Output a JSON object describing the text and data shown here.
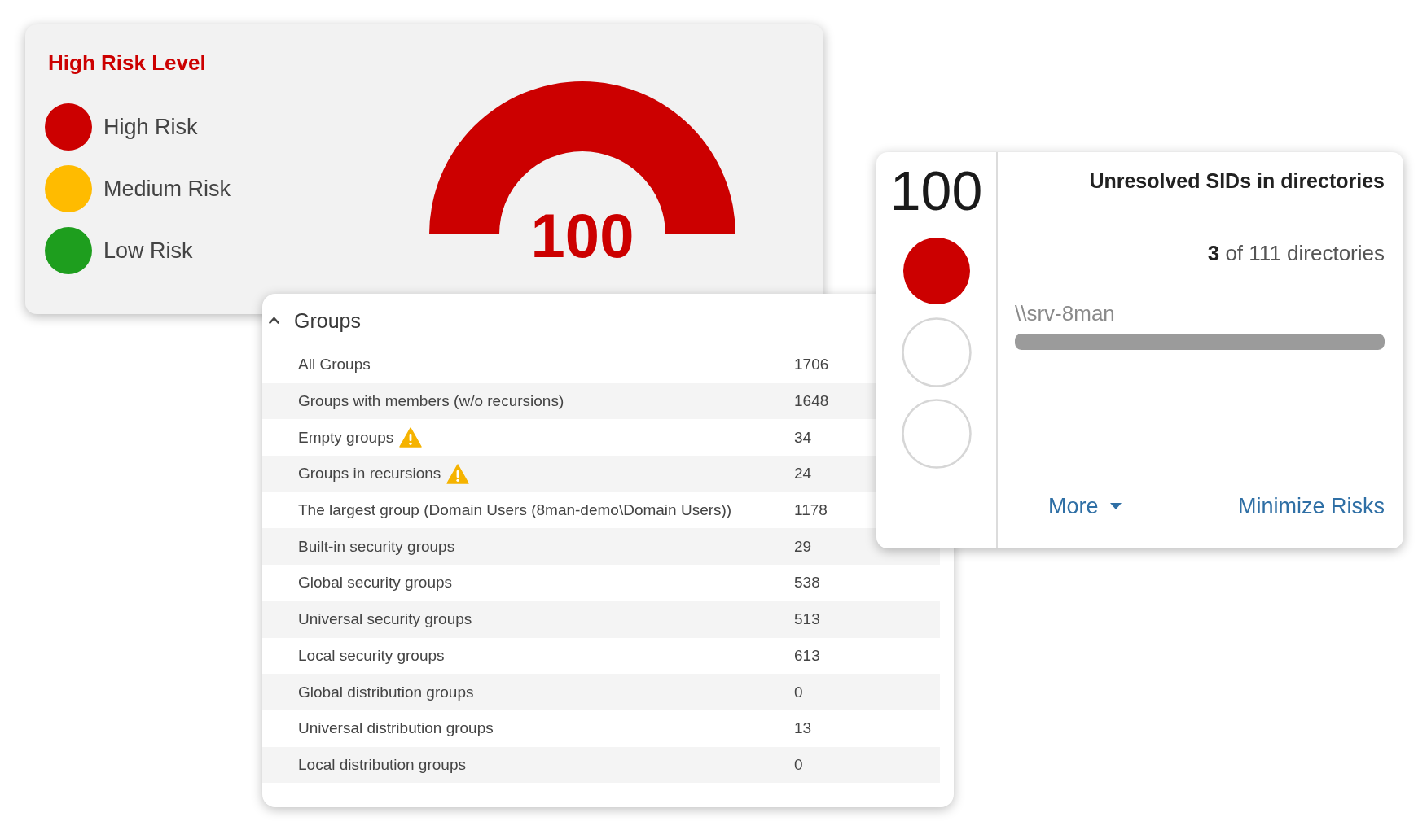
{
  "risk_card": {
    "title": "High Risk Level",
    "legend": [
      {
        "label": "High Risk",
        "color": "#cc0000"
      },
      {
        "label": "Medium Risk",
        "color": "#ffbb00"
      },
      {
        "label": "Low Risk",
        "color": "#1e9e1e"
      }
    ],
    "gauge": {
      "level": 1,
      "reading": "100"
    }
  },
  "groups_panel": {
    "title": "Groups",
    "expanded": true,
    "rows": [
      {
        "label": "All Groups",
        "value": "1706",
        "warning": false
      },
      {
        "label": "Groups with members (w/o recursions)",
        "value": "1648",
        "warning": false
      },
      {
        "label": "Empty groups",
        "value": "34",
        "warning": true
      },
      {
        "label": "Groups in recursions",
        "value": "24",
        "warning": true
      },
      {
        "label": "The largest group (Domain Users (8man-demo\\Domain Users))",
        "value": "1178",
        "warning": false
      },
      {
        "label": "Built-in security groups",
        "value": "29",
        "warning": false
      },
      {
        "label": "Global security groups",
        "value": "538",
        "warning": false
      },
      {
        "label": "Universal security groups",
        "value": "513",
        "warning": false
      },
      {
        "label": "Local security groups",
        "value": "613",
        "warning": false
      },
      {
        "label": "Global distribution groups",
        "value": "0",
        "warning": false
      },
      {
        "label": "Universal distribution groups",
        "value": "13",
        "warning": false
      },
      {
        "label": "Local distribution groups",
        "value": "0",
        "warning": false
      }
    ]
  },
  "sid_card": {
    "score": "100",
    "lights": [
      {
        "on": true
      },
      {
        "on": false
      },
      {
        "on": false
      }
    ],
    "title": "Unresolved SIDs in directories",
    "summary": "**3** of 111 directories",
    "directories": [
      {
        "name": "\\\\srv-8man",
        "level": 1
      }
    ],
    "links": [
      {
        "label": "More",
        "kind": "dropdown"
      },
      {
        "label": "Minimize Risks",
        "kind": "plain"
      }
    ]
  }
}
